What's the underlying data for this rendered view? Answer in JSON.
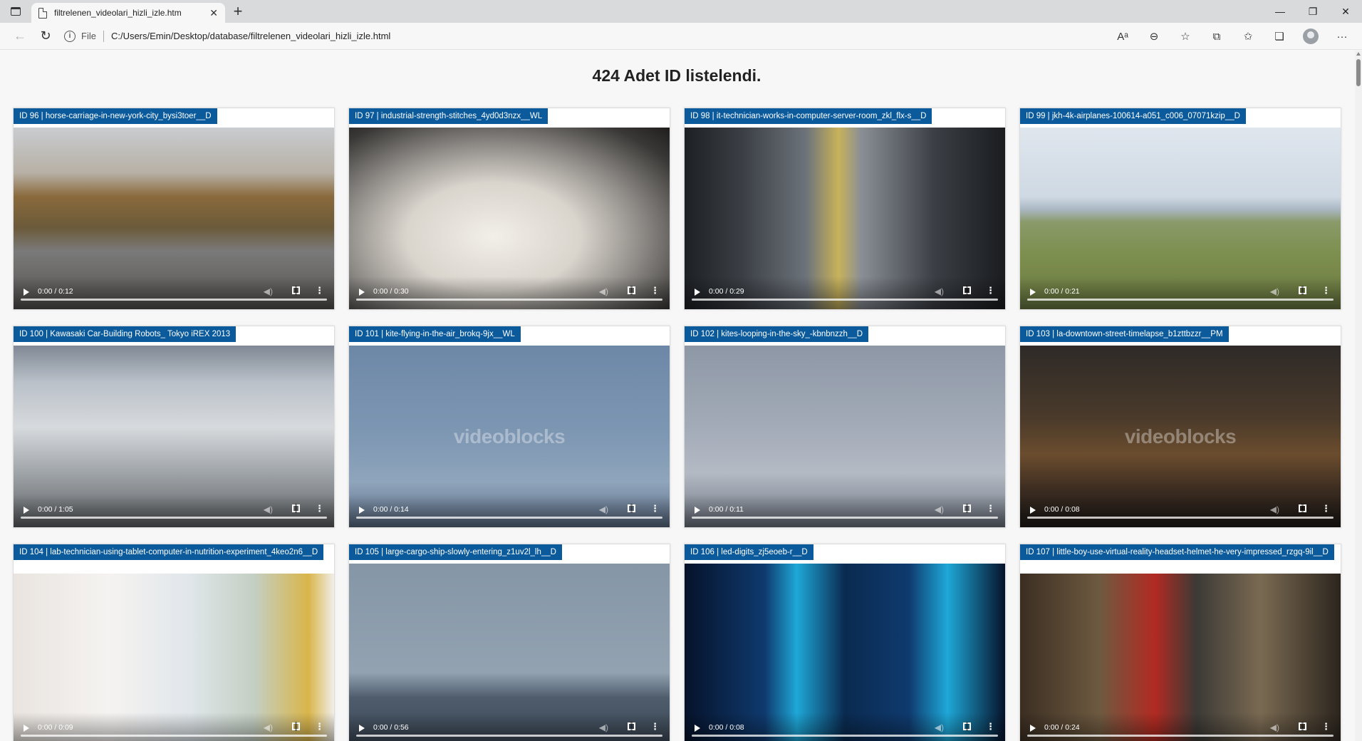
{
  "browser": {
    "tab_title": "filtrelenen_videolari_hizli_izle.htm",
    "address_scheme": "File",
    "address_path": "C:/Users/Emin/Desktop/database/filtrelenen_videolari_hizli_izle.html"
  },
  "page": {
    "heading": "424 Adet ID listelendi.",
    "watermark": "videoblocks"
  },
  "videos": [
    {
      "label": "ID 96 | horse-carriage-in-new-york-city_bysi3toer__D",
      "time": "0:00 / 0:12"
    },
    {
      "label": "ID 97 | industrial-strength-stitches_4yd0d3nzx__WL",
      "time": "0:00 / 0:30"
    },
    {
      "label": "ID 98 | it-technician-works-in-computer-server-room_zkl_flx-s__D",
      "time": "0:00 / 0:29"
    },
    {
      "label": "ID 99 | jkh-4k-airplanes-100614-a051_c006_07071kzip__D",
      "time": "0:00 / 0:21"
    },
    {
      "label": "ID 100 | Kawasaki Car-Building Robots_ Tokyo iREX 2013",
      "time": "0:00 / 1:05"
    },
    {
      "label": "ID 101 | kite-flying-in-the-air_brokq-9jx__WL",
      "time": "0:00 / 0:14"
    },
    {
      "label": "ID 102 | kites-looping-in-the-sky_-kbnbnzzh__D",
      "time": "0:00 / 0:11"
    },
    {
      "label": "ID 103 | la-downtown-street-timelapse_b1zttbzzr__PM",
      "time": "0:00 / 0:08"
    },
    {
      "label": "ID 104 | lab-technician-using-tablet-computer-in-nutrition-experiment_4keo2n6__D",
      "time": "0:00 / 0:09"
    },
    {
      "label": "ID 105 | large-cargo-ship-slowly-entering_z1uv2l_lh__D",
      "time": "0:00 / 0:56"
    },
    {
      "label": "ID 106 | led-digits_zj5eoeb-r__D",
      "time": "0:00 / 0:08"
    },
    {
      "label": "ID 107 | little-boy-use-virtual-reality-headset-helmet-he-very-impressed_rzgq-9il__D",
      "time": "0:00 / 0:24"
    }
  ]
}
